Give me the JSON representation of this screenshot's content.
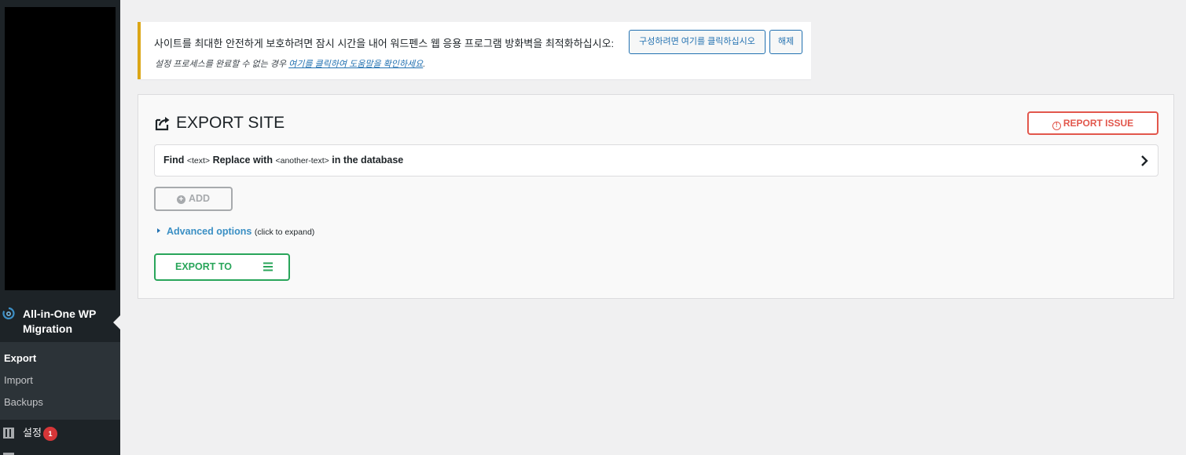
{
  "sidebar": {
    "plugin_title": "All-in-One WP Migration",
    "submenu": [
      {
        "label": "Export",
        "current": true
      },
      {
        "label": "Import",
        "current": false
      },
      {
        "label": "Backups",
        "current": false
      }
    ],
    "settings_label": "설정",
    "settings_badge": "1"
  },
  "notice": {
    "message": "사이트를 최대한 안전하게 보호하려면 잠시 시간을 내어 워드펜스 웹 응용 프로그램 방화벽을 최적화하십시오:",
    "configure_button": "구성하려면 여기를 클릭하십시오",
    "dismiss_button": "해제",
    "help_prefix": "설정 프로세스를 완료할 수 없는 경우 ",
    "help_link": "여기를 클릭하여 도움말을 확인하세요",
    "help_suffix": "."
  },
  "panel": {
    "title": "EXPORT SITE",
    "report_button": "REPORT ISSUE",
    "find_bar": {
      "find": "Find",
      "text_token": "<text>",
      "replace_with": "Replace with",
      "another_token": "<another-text>",
      "in_database": "in the database"
    },
    "add_button": "ADD",
    "advanced_link": "Advanced options",
    "advanced_hint": "(click to expand)",
    "export_button": "EXPORT TO"
  },
  "colors": {
    "sidebar_bg": "#1d2327",
    "submenu_bg": "#2c3338",
    "notice_border": "#dba617",
    "report_red": "#e2574c",
    "export_green": "#29a55a",
    "link_blue": "#2271b1",
    "badge_red": "#d63638"
  },
  "icons": {
    "plugin_logo": "ai1wm-logo-icon",
    "export_title": "export-share-icon",
    "report": "warning-circle-icon",
    "find_chevron": "chevron-right-icon",
    "add": "plus-circle-icon",
    "advanced": "triangle-right-icon",
    "export_menu": "hamburger-menu-icon",
    "settings": "settings-sliders-icon"
  }
}
